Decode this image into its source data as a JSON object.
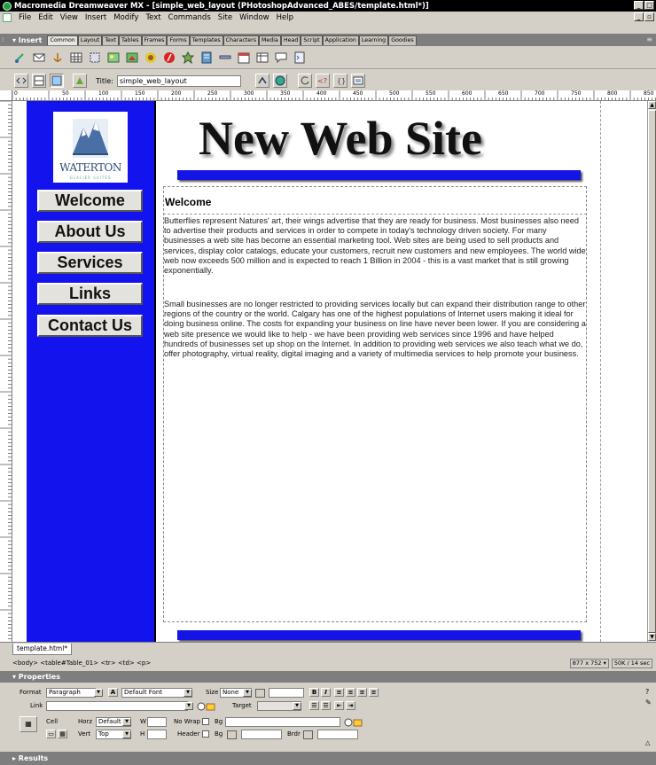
{
  "window": {
    "title": "Macromedia Dreamweaver MX - [simple_web_layout (PHotoshopAdvanced_ABES/template.html*)]"
  },
  "menu": [
    "File",
    "Edit",
    "View",
    "Insert",
    "Modify",
    "Text",
    "Commands",
    "Site",
    "Window",
    "Help"
  ],
  "insert_bar": {
    "label": "▾ Insert",
    "tabs": [
      "Common",
      "Layout",
      "Text",
      "Tables",
      "Frames",
      "Forms",
      "Templates",
      "Characters",
      "Media",
      "Head",
      "Script",
      "Application",
      "Learning",
      "Goodies"
    ],
    "active_tab": "Common"
  },
  "doc_toolbar": {
    "title_label": "Title:",
    "title_value": "simple_web_layout"
  },
  "ruler": {
    "marks": [
      "0",
      "50",
      "100",
      "150",
      "200",
      "250",
      "300",
      "350",
      "400",
      "450",
      "500",
      "550",
      "600",
      "650",
      "700",
      "750",
      "800",
      "850"
    ]
  },
  "page": {
    "site_title": "New Web Site",
    "logo_text": "WATERTON",
    "logo_subtext": "GLACIER SUITES",
    "nav": [
      "Welcome",
      "About Us",
      "Services",
      "Links",
      "Contact Us"
    ],
    "heading": "Welcome",
    "paragraph1": "Butterflies represent Natures' art, their wings advertise that they are ready for business. Most businesses also need to advertise their products and services in order to compete in today's technology driven society. For many businesses a web site has become an essential marketing tool. Web sites are being used to sell products and services, display color catalogs, educate your customers, recruit new customers and new employees. The world wide web now exceeds 500 million and is expected to reach 1 Billion in 2004 - this is a vast market that is still growing exponentially.",
    "paragraph2": "Small businesses are no longer restricted to providing services locally but can expand their distribution range to other regions of the country or the world. Calgary has one of the highest populations of Internet users making it ideal for doing business online. The costs for expanding your business on line have never been lower. If you are considering a web site presence we would like to help - we have been providing web services since 1996 and have helped hundreds of businesses set up shop on the Internet. In addition to providing web services we also teach what we do, offer photography, virtual reality, digital imaging and a variety of multimedia services to help promote your business."
  },
  "doc_tab": "template.html*",
  "status": {
    "tag_selector": "<body> <table#Table_01> <tr> <td> <p>",
    "window_size": "877 x 752 ▾",
    "doc_size": "50K / 14 sec"
  },
  "properties": {
    "header": "▾ Properties",
    "format_label": "Format",
    "format_value": "Paragraph",
    "font_value": "Default Font",
    "size_label": "Size",
    "size_value": "None",
    "link_label": "Link",
    "target_label": "Target",
    "cell_label": "Cell",
    "horz_label": "Horz",
    "horz_value": "Default",
    "vert_label": "Vert",
    "vert_value": "Top",
    "w_label": "W",
    "h_label": "H",
    "nowrap_label": "No Wrap",
    "header_label": "Header",
    "bg_label": "Bg",
    "brdr_label": "Brdr"
  },
  "results": "▸ Results"
}
